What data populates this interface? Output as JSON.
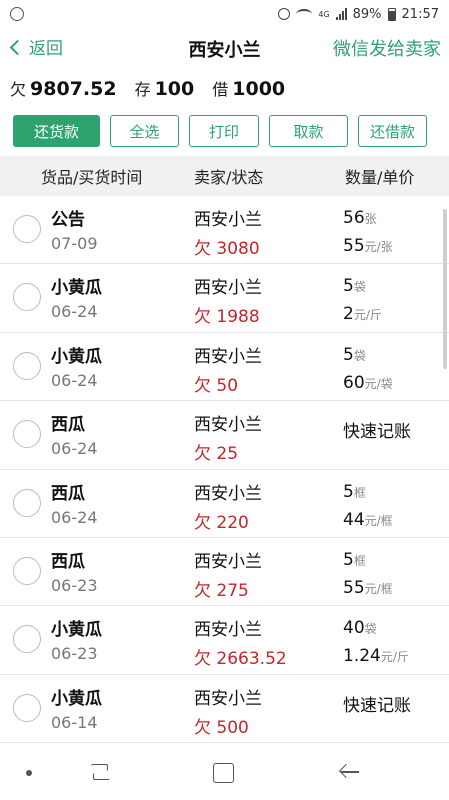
{
  "status_bar": {
    "network": "4G",
    "battery": "89%",
    "time": "21:57"
  },
  "nav": {
    "back_label": "返回",
    "title": "西安小兰",
    "wechat_label": "微信发给卖家"
  },
  "summary": {
    "owe_label": "欠",
    "owe_value": "9807.52",
    "deposit_label": "存",
    "deposit_value": "100",
    "borrow_label": "借",
    "borrow_value": "1000"
  },
  "buttons": [
    "还货款",
    "全选",
    "打印",
    "取款",
    "还借款"
  ],
  "table": {
    "headers": [
      "货品/买货时间",
      "卖家/状态",
      "数量/单价"
    ],
    "rows": [
      {
        "goods": "公告",
        "date": "07-09",
        "seller": "西安小兰",
        "debt": "欠 3080",
        "qty": "56",
        "qty_unit": "张",
        "price": "55",
        "price_unit": "元/张",
        "quick": ""
      },
      {
        "goods": "小黄瓜",
        "date": "06-24",
        "seller": "西安小兰",
        "debt": "欠 1988",
        "qty": "5",
        "qty_unit": "袋",
        "price": "2",
        "price_unit": "元/斤",
        "quick": ""
      },
      {
        "goods": "小黄瓜",
        "date": "06-24",
        "seller": "西安小兰",
        "debt": "欠 50",
        "qty": "5",
        "qty_unit": "袋",
        "price": "60",
        "price_unit": "元/袋",
        "quick": ""
      },
      {
        "goods": "西瓜",
        "date": "06-24",
        "seller": "西安小兰",
        "debt": "欠 25",
        "qty": "",
        "qty_unit": "",
        "price": "",
        "price_unit": "",
        "quick": "快速记账"
      },
      {
        "goods": "西瓜",
        "date": "06-24",
        "seller": "西安小兰",
        "debt": "欠 220",
        "qty": "5",
        "qty_unit": "框",
        "price": "44",
        "price_unit": "元/框",
        "quick": ""
      },
      {
        "goods": "西瓜",
        "date": "06-23",
        "seller": "西安小兰",
        "debt": "欠 275",
        "qty": "5",
        "qty_unit": "框",
        "price": "55",
        "price_unit": "元/框",
        "quick": ""
      },
      {
        "goods": "小黄瓜",
        "date": "06-23",
        "seller": "西安小兰",
        "debt": "欠 2663.52",
        "qty": "40",
        "qty_unit": "袋",
        "price": "1.24",
        "price_unit": "元/斤",
        "quick": ""
      },
      {
        "goods": "小黄瓜",
        "date": "06-14",
        "seller": "西安小兰",
        "debt": "欠 500",
        "qty": "",
        "qty_unit": "",
        "price": "",
        "price_unit": "",
        "quick": "快速记账"
      }
    ]
  },
  "colors": {
    "accent": "#2ea36f",
    "debt": "#c0272d"
  }
}
